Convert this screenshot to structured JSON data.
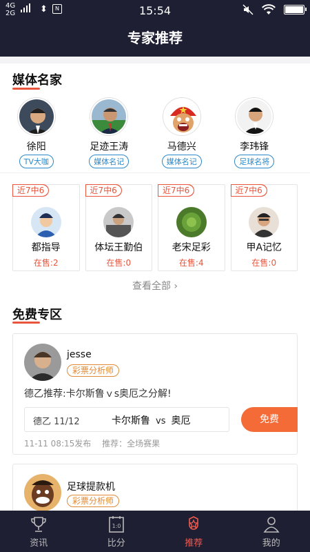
{
  "status_bar": {
    "network_top": "4G",
    "network_bottom": "2G",
    "time": "15:54"
  },
  "header": {
    "title": "专家推荐"
  },
  "media_section": {
    "title": "媒体名家",
    "experts": [
      {
        "name": "徐阳",
        "tag": "TV大咖"
      },
      {
        "name": "足迹王涛",
        "tag": "媒体名记"
      },
      {
        "name": "马德兴",
        "tag": "媒体名记"
      },
      {
        "name": "李玮锋",
        "tag": "足球名将"
      }
    ],
    "records": [
      {
        "badge": "近7中6",
        "name": "都指导",
        "sale": "在售:2"
      },
      {
        "badge": "近7中6",
        "name": "体坛王勤伯",
        "sale": "在售:0"
      },
      {
        "badge": "近7中6",
        "name": "老宋足彩",
        "sale": "在售:4"
      },
      {
        "badge": "近7中6",
        "name": "甲A记忆",
        "sale": "在售:0"
      }
    ],
    "view_all": "查看全部"
  },
  "free_section": {
    "title": "免费专区",
    "cards": [
      {
        "author": "jesse",
        "role": "彩票分析师",
        "pick_title": "德乙推荐:卡尔斯鲁ｖs奥厄之分解!",
        "league_date": "德乙 11/12",
        "home": "卡尔斯鲁",
        "vs": "vs",
        "away": "奥厄",
        "button": "免费",
        "published": "11-11 08:15发布",
        "recommend": "推荐：全场赛果"
      },
      {
        "author": "足球提款机",
        "role": "彩票分析师"
      }
    ]
  },
  "tabbar": {
    "tabs": [
      {
        "label": "资讯",
        "icon": "trophy-icon"
      },
      {
        "label": "比分",
        "icon": "scoreboard-icon",
        "icon_text": "1:0"
      },
      {
        "label": "推荐",
        "icon": "star-icon",
        "active": true
      },
      {
        "label": "我的",
        "icon": "person-icon"
      }
    ]
  },
  "colors": {
    "header_bg": "#1e1f33",
    "accent": "#e8553c",
    "free_button": "#f46b38",
    "tag_blue": "#2b88c9",
    "role_orange": "#e08a37"
  }
}
